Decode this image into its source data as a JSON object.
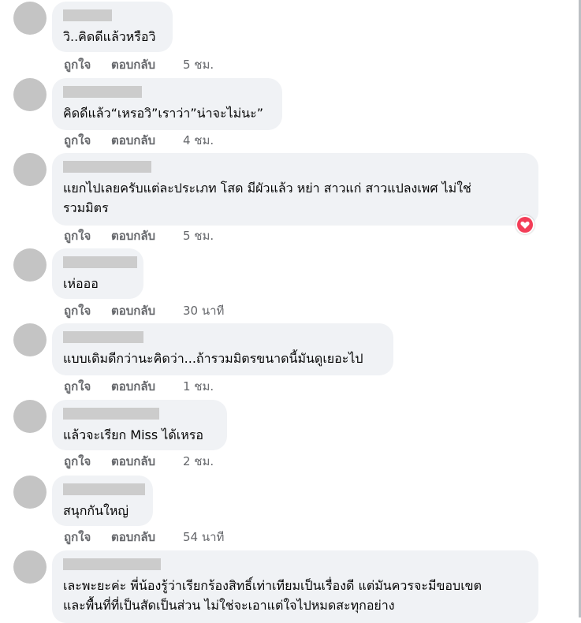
{
  "actions": {
    "like": "ถูกใจ",
    "reply": "ตอบกลับ"
  },
  "comments": [
    {
      "lines": [
        "วิ..คิดดีแล้วหรือวิ"
      ],
      "time": "5 ชม."
    },
    {
      "lines": [
        "คิดดีแล้ว“เหรอวิ”เราว่า”น่าจะไม่นะ”"
      ],
      "time": "4 ชม."
    },
    {
      "lines": [
        "แยกไปเลยครับแต่ละประเภท โสด มีผัวแล้ว หย่า สาวแก่ สาวแปลงเพศ ไม่ใช่",
        "รวมมิตร"
      ],
      "time": "5 ชม.",
      "reaction": "love-icon"
    },
    {
      "lines": [
        "เห่อออ"
      ],
      "time": "30 นาที"
    },
    {
      "lines": [
        "แบบเดิมดีกว่านะคิดว่า...ถ้ารวมมิตรขนาดนี้มันดูเยอะไป"
      ],
      "time": "1 ชม."
    },
    {
      "lines": [
        "แล้วจะเรียก Miss ได้เหรอ"
      ],
      "time": "2 ชม."
    },
    {
      "lines": [
        "สนุกกันใหญ่"
      ],
      "time": "54 นาที"
    },
    {
      "lines": [
        "เละพะยะค่ะ พี่น้องรู้ว่าเรียกร้องสิทธิ์เท่าเทียมเป็นเรื่องดี แต่มันควรจะมีขอบเขต",
        "และพื้นที่ที่เป็นสัดเป็นส่วน ไม่ใช่จะเอาแต่ใจไปหมดสะทุกอย่าง"
      ]
    }
  ],
  "colors": {
    "bubble": "#f0f2f5",
    "redaction": "#cccccc",
    "avatar": "#c4c4c4",
    "meta": "#65676b",
    "love": "#f33e58"
  }
}
